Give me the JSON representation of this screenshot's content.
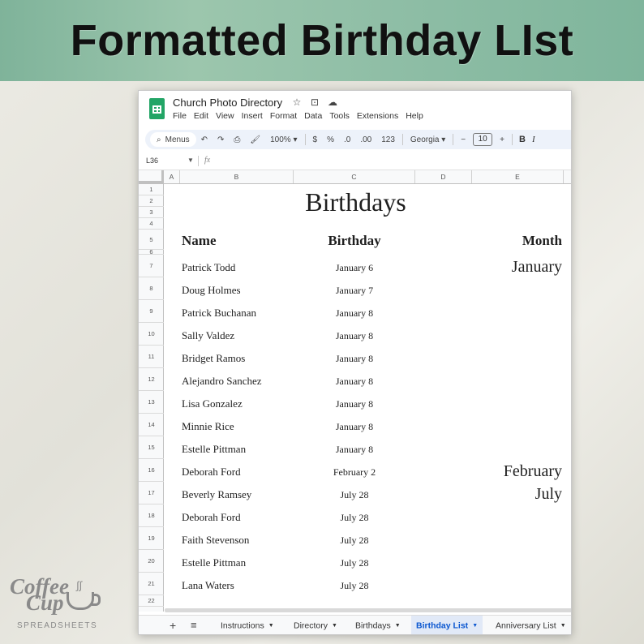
{
  "banner": {
    "title": "Formatted Birthday LIst"
  },
  "app": {
    "doc_title": "Church Photo Directory",
    "title_icons": [
      "star-icon",
      "move-to-folder-icon",
      "cloud-saved-icon"
    ],
    "menus": [
      "File",
      "Edit",
      "View",
      "Insert",
      "Format",
      "Data",
      "Tools",
      "Extensions",
      "Help"
    ]
  },
  "toolbar": {
    "search_label": "Menus",
    "zoom": "100%",
    "currency": "$",
    "percent": "%",
    "dec_decrease": ".0",
    "dec_increase": ".00",
    "number_format": "123",
    "font": "Georgia",
    "font_size": "10",
    "minus": "−",
    "plus": "+",
    "bold": "B",
    "italic": "I"
  },
  "formula_bar": {
    "cell_ref": "L36",
    "fx": "fx"
  },
  "columns": [
    "A",
    "B",
    "C",
    "D",
    "E"
  ],
  "rows": [
    "1",
    "2",
    "3",
    "4",
    "5",
    "6",
    "7",
    "8",
    "9",
    "10",
    "11",
    "12",
    "13",
    "14",
    "15",
    "16",
    "17",
    "18",
    "19",
    "20",
    "21",
    "22"
  ],
  "sheet": {
    "title": "Birthdays",
    "headers": {
      "name": "Name",
      "birthday": "Birthday",
      "month": "Month"
    },
    "entries": [
      {
        "name": "Patrick Todd",
        "birthday": "January 6"
      },
      {
        "name": "Doug Holmes",
        "birthday": "January 7"
      },
      {
        "name": "Patrick Buchanan",
        "birthday": "January 8"
      },
      {
        "name": "Sally Valdez",
        "birthday": "January 8"
      },
      {
        "name": "Bridget Ramos",
        "birthday": "January 8"
      },
      {
        "name": "Alejandro Sanchez",
        "birthday": "January 8"
      },
      {
        "name": "Lisa Gonzalez",
        "birthday": "January 8"
      },
      {
        "name": "Minnie Rice",
        "birthday": "January 8"
      },
      {
        "name": "Estelle Pittman",
        "birthday": "January 8"
      },
      {
        "name": "Deborah Ford",
        "birthday": "February 2"
      },
      {
        "name": "Beverly Ramsey",
        "birthday": "July 28"
      },
      {
        "name": "Deborah Ford",
        "birthday": "July 28"
      },
      {
        "name": "Faith Stevenson",
        "birthday": "July 28"
      },
      {
        "name": "Estelle Pittman",
        "birthday": "July 28"
      },
      {
        "name": "Lana Waters",
        "birthday": "July 28"
      }
    ],
    "months": [
      {
        "label": "January",
        "row": 7
      },
      {
        "label": "February",
        "row": 16
      },
      {
        "label": "July",
        "row": 17
      }
    ]
  },
  "tabs": {
    "add": "+",
    "list": "≡",
    "items": [
      {
        "label": "Instructions",
        "active": false
      },
      {
        "label": "Directory",
        "active": false
      },
      {
        "label": "Birthdays",
        "active": false
      },
      {
        "label": "Birthday List",
        "active": true
      },
      {
        "label": "Anniversary List",
        "active": false
      }
    ]
  },
  "logo": {
    "line1": "Coffee",
    "line2": "Cup",
    "sub": "SPREADSHEETS"
  },
  "colors": {
    "banner": "#8fbea6",
    "sheets_green": "#23a566",
    "active_tab": "#0b57d0"
  }
}
